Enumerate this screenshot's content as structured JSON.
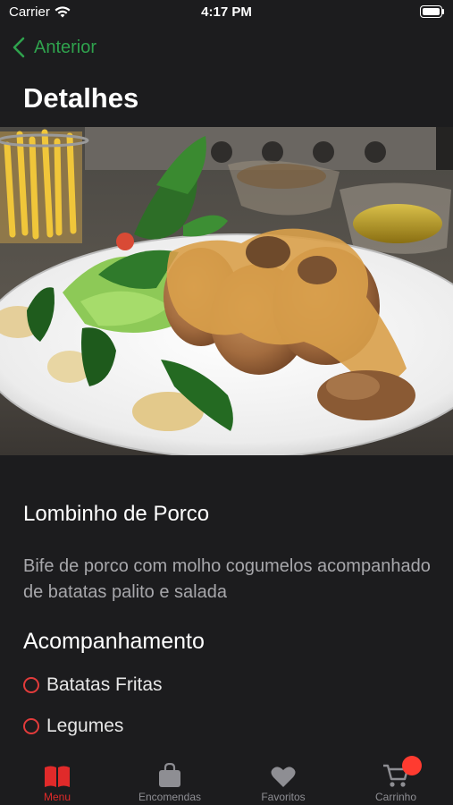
{
  "status_bar": {
    "carrier": "Carrier",
    "time": "4:17 PM"
  },
  "nav": {
    "back_label": "Anterior",
    "title": "Detalhes"
  },
  "dish": {
    "name": "Lombinho de Porco",
    "description": "Bife de porco com molho cogumelos acompanhado de batatas palito e salada",
    "image_icon": "food-photo"
  },
  "accompaniment": {
    "title": "Acompanhamento",
    "options": [
      {
        "label": "Batatas Fritas",
        "selected": false
      },
      {
        "label": "Legumes",
        "selected": false
      }
    ]
  },
  "tabs": [
    {
      "label": "Menu",
      "icon": "book-icon",
      "active": true
    },
    {
      "label": "Encomendas",
      "icon": "bag-icon",
      "active": false
    },
    {
      "label": "Favoritos",
      "icon": "heart-icon",
      "active": false
    },
    {
      "label": "Carrinho",
      "icon": "cart-icon",
      "active": false
    }
  ],
  "colors": {
    "background": "#1c1c1e",
    "accent_green": "#2fa24d",
    "accent_red": "#e02a2a",
    "badge_red": "#ff3b30",
    "secondary_text": "#a7a7ab",
    "inactive_tab": "#8e8e93"
  }
}
